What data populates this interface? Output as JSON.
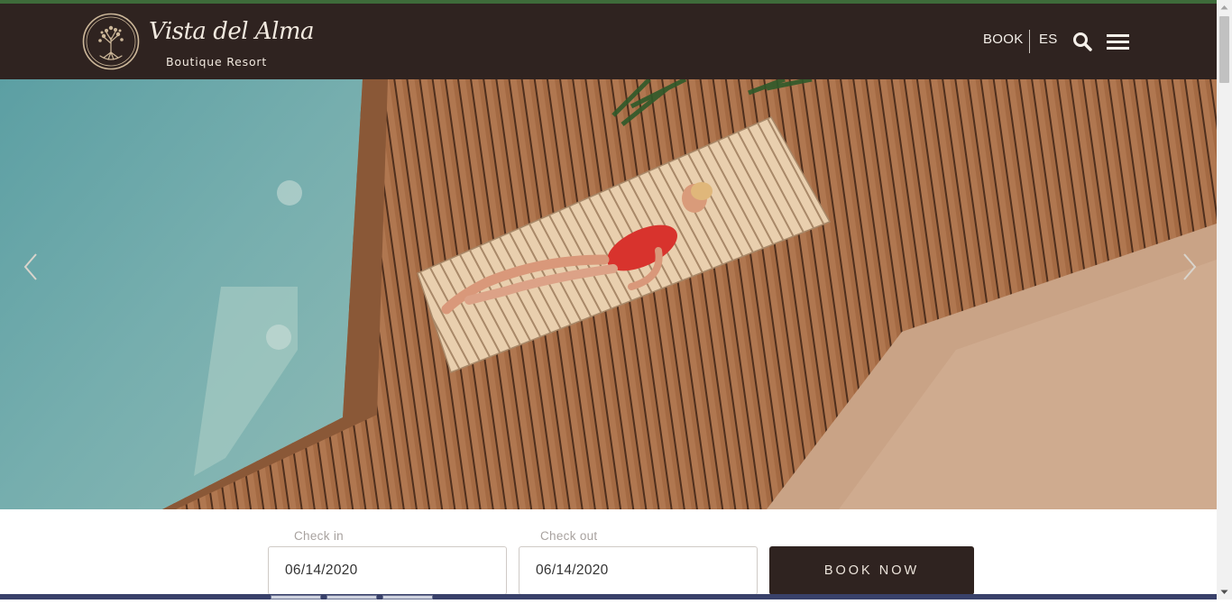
{
  "brand": {
    "name": "Vista del Alma",
    "subtitle": "Boutique Resort"
  },
  "nav": {
    "book_label": "BOOK",
    "lang_label": "ES",
    "search_icon": "search-icon",
    "menu_icon": "hamburger-menu-icon"
  },
  "hero": {
    "prev_icon": "chevron-left-icon",
    "next_icon": "chevron-right-icon"
  },
  "booking": {
    "checkin_label": "Check in",
    "checkin_value": "06/14/2020",
    "checkout_label": "Check out",
    "checkout_value": "06/14/2020",
    "button_label": "BOOK NOW"
  },
  "colors": {
    "header_bg": "#2f2320",
    "accent_line": "#3e6b3a",
    "button_bg": "#2f2320",
    "text_light": "#f5f0ea"
  }
}
